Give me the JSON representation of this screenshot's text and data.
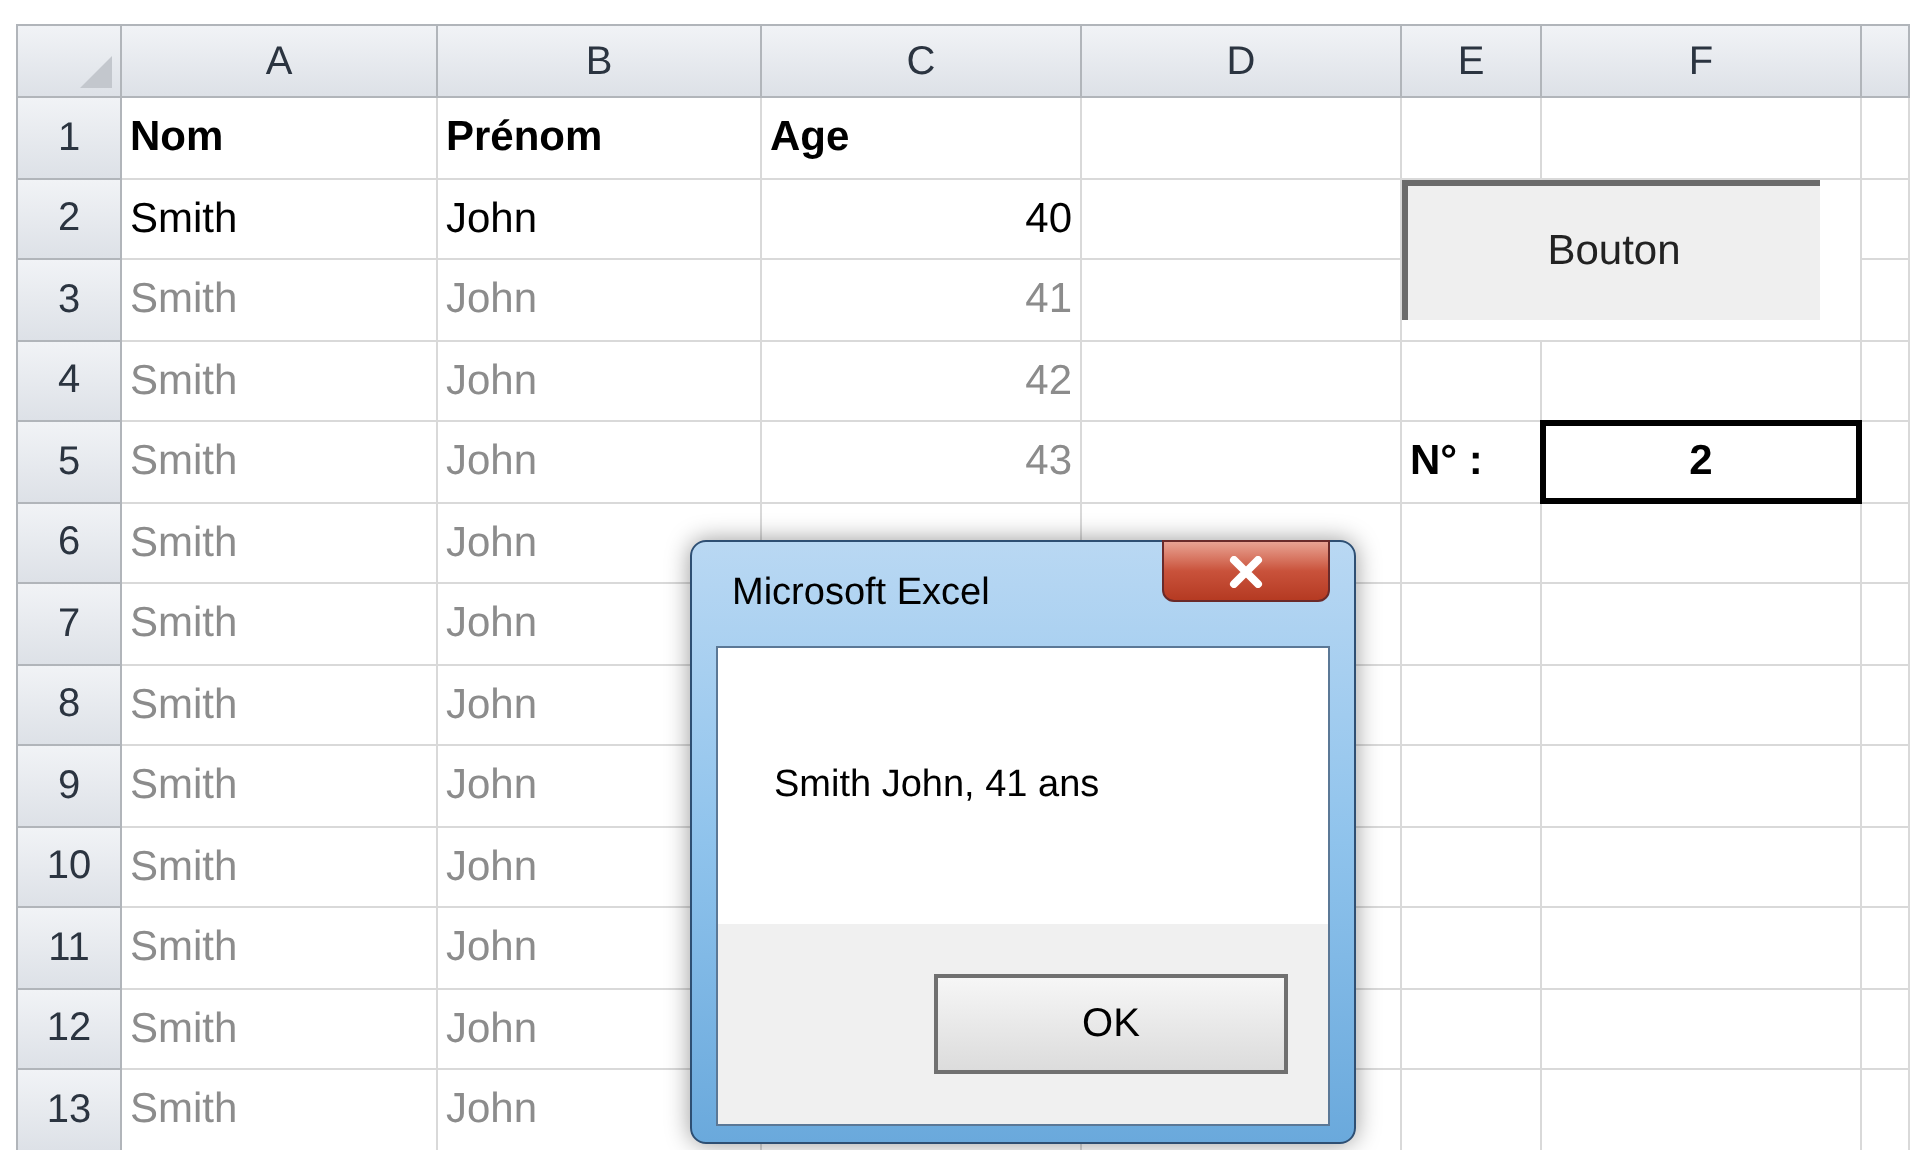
{
  "sheet": {
    "columns": [
      "A",
      "B",
      "C",
      "D",
      "E",
      "F"
    ],
    "rows": [
      {
        "number": "1",
        "kind": "header",
        "cells": [
          "Nom",
          "Prénom",
          "Age"
        ]
      },
      {
        "number": "2",
        "kind": "data",
        "dimmed": false,
        "cells": [
          "Smith",
          "John",
          "40"
        ]
      },
      {
        "number": "3",
        "kind": "data",
        "dimmed": true,
        "cells": [
          "Smith",
          "John",
          "41"
        ]
      },
      {
        "number": "4",
        "kind": "data",
        "dimmed": true,
        "cells": [
          "Smith",
          "John",
          "42"
        ]
      },
      {
        "number": "5",
        "kind": "data",
        "dimmed": true,
        "cells": [
          "Smith",
          "John",
          "43"
        ],
        "counter": {
          "label": "N° :",
          "value": "2"
        }
      },
      {
        "number": "6",
        "kind": "data",
        "dimmed": true,
        "cells": [
          "Smith",
          "John"
        ]
      },
      {
        "number": "7",
        "kind": "data",
        "dimmed": true,
        "cells": [
          "Smith",
          "John"
        ]
      },
      {
        "number": "8",
        "kind": "data",
        "dimmed": true,
        "cells": [
          "Smith",
          "John"
        ]
      },
      {
        "number": "9",
        "kind": "data",
        "dimmed": true,
        "cells": [
          "Smith",
          "John"
        ]
      },
      {
        "number": "10",
        "kind": "data",
        "dimmed": true,
        "cells": [
          "Smith",
          "John"
        ]
      },
      {
        "number": "11",
        "kind": "data",
        "dimmed": true,
        "cells": [
          "Smith",
          "John"
        ]
      },
      {
        "number": "12",
        "kind": "data",
        "dimmed": true,
        "cells": [
          "Smith",
          "John"
        ]
      },
      {
        "number": "13",
        "kind": "data",
        "dimmed": true,
        "cells": [
          "Smith",
          "John"
        ]
      }
    ],
    "button": {
      "label": "Bouton"
    }
  },
  "dialog": {
    "title": "Microsoft Excel",
    "message": "Smith John, 41 ans",
    "buttons": [
      "OK"
    ]
  }
}
